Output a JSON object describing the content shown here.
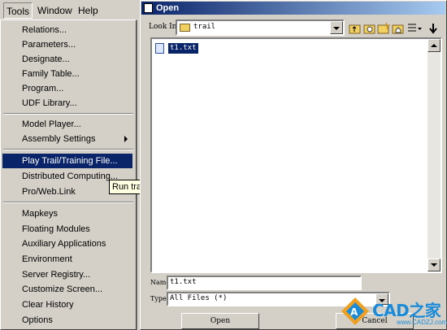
{
  "menubar": {
    "tools": "Tools",
    "window": "Window",
    "help": "Help"
  },
  "tools_menu": {
    "items": [
      {
        "label": "Relations..."
      },
      {
        "label": "Parameters..."
      },
      {
        "label": "Designate..."
      },
      {
        "label": "Family Table..."
      },
      {
        "label": "Program..."
      },
      {
        "label": "UDF Library..."
      },
      {
        "label": "Model Player..."
      },
      {
        "label": "Assembly Settings"
      },
      {
        "label": "Play Trail/Training File..."
      },
      {
        "label": "Distributed Computing..."
      },
      {
        "label": "Pro/Web.Link"
      },
      {
        "label": "Mapkeys"
      },
      {
        "label": "Floating Modules"
      },
      {
        "label": "Auxiliary Applications"
      },
      {
        "label": "Environment"
      },
      {
        "label": "Server Registry..."
      },
      {
        "label": "Customize Screen..."
      },
      {
        "label": "Clear History"
      },
      {
        "label": "Options"
      }
    ],
    "highlighted": "Play Trail/Training File...",
    "tooltip": "Run tra"
  },
  "dialog": {
    "title": "Open",
    "look_in_label": "Look In",
    "look_in_value": "trail",
    "files": [
      {
        "name": "t1.txt"
      }
    ],
    "name_label": "Name",
    "name_value": "t1.txt",
    "type_label": "Type",
    "type_value": "All Files (*)",
    "open_button": "Open",
    "cancel_button": "Cancel"
  },
  "watermark": {
    "brand": "CAD之家",
    "site": "www.CADZJ.com"
  },
  "colors": {
    "highlight": "#0a246a",
    "face": "#d4d0c8",
    "brand": "#1a8bd8"
  }
}
